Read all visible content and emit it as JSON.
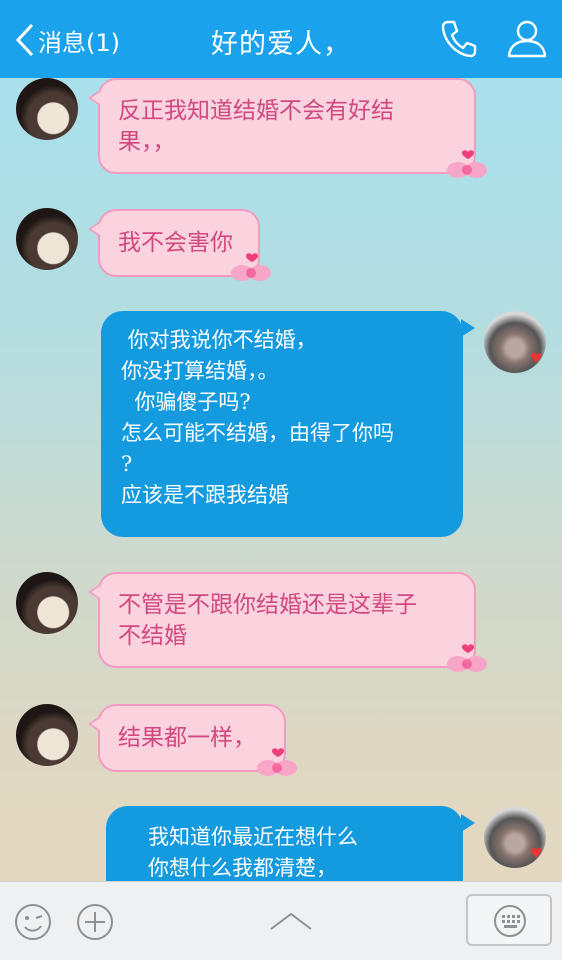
{
  "header": {
    "back_label": "消息(1)",
    "title": "好的爱人，",
    "call_icon": "phone-icon",
    "profile_icon": "person-icon",
    "background": "#1aa3ec"
  },
  "messages": [
    {
      "from": "her",
      "lines": [
        "反正我知道结婚不会有好结",
        "果，，"
      ]
    },
    {
      "from": "her",
      "lines": [
        "我不会害你"
      ]
    },
    {
      "from": "me",
      "lines": [
        " 你对我说你不结婚，",
        "你没打算结婚，。",
        "  你骗傻子吗?",
        "怎么可能不结婚，由得了你吗",
        "?",
        "应该是不跟我结婚"
      ]
    },
    {
      "from": "her",
      "lines": [
        "不管是不跟你结婚还是这辈子",
        "不结婚"
      ]
    },
    {
      "from": "her",
      "lines": [
        "结果都一样，"
      ]
    },
    {
      "from": "me",
      "lines": [
        "我知道你最近在想什么",
        "你想什么我都清楚，"
      ]
    }
  ],
  "colors": {
    "pink_bubble": "#fbd3df",
    "pink_text": "#d1477f",
    "blue_bubble": "#149adf"
  },
  "bottom": {
    "emoji_icon": "emoji-face-icon",
    "plus_icon": "plus-circle-icon",
    "expand_icon": "chevron-up-icon",
    "keyboard_icon": "keyboard-icon"
  }
}
